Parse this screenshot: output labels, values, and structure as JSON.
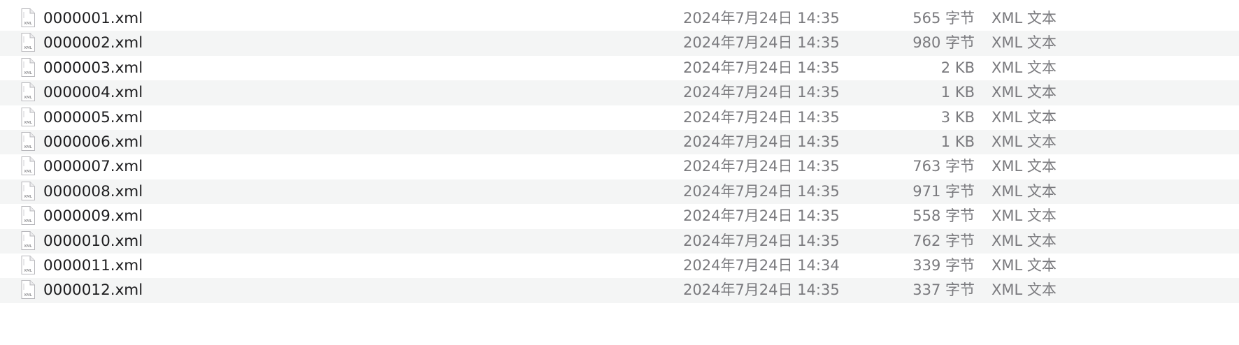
{
  "icon": {
    "name": "xml-file-icon",
    "label": "XML"
  },
  "files": [
    {
      "name": "0000001.xml",
      "date": "2024年7月24日 14:35",
      "size": "565 字节",
      "kind": "XML 文本"
    },
    {
      "name": "0000002.xml",
      "date": "2024年7月24日 14:35",
      "size": "980 字节",
      "kind": "XML 文本"
    },
    {
      "name": "0000003.xml",
      "date": "2024年7月24日 14:35",
      "size": "2 KB",
      "kind": "XML 文本"
    },
    {
      "name": "0000004.xml",
      "date": "2024年7月24日 14:35",
      "size": "1 KB",
      "kind": "XML 文本"
    },
    {
      "name": "0000005.xml",
      "date": "2024年7月24日 14:35",
      "size": "3 KB",
      "kind": "XML 文本"
    },
    {
      "name": "0000006.xml",
      "date": "2024年7月24日 14:35",
      "size": "1 KB",
      "kind": "XML 文本"
    },
    {
      "name": "0000007.xml",
      "date": "2024年7月24日 14:35",
      "size": "763 字节",
      "kind": "XML 文本"
    },
    {
      "name": "0000008.xml",
      "date": "2024年7月24日 14:35",
      "size": "971 字节",
      "kind": "XML 文本"
    },
    {
      "name": "0000009.xml",
      "date": "2024年7月24日 14:35",
      "size": "558 字节",
      "kind": "XML 文本"
    },
    {
      "name": "0000010.xml",
      "date": "2024年7月24日 14:35",
      "size": "762 字节",
      "kind": "XML 文本"
    },
    {
      "name": "0000011.xml",
      "date": "2024年7月24日 14:34",
      "size": "339 字节",
      "kind": "XML 文本"
    },
    {
      "name": "0000012.xml",
      "date": "2024年7月24日 14:35",
      "size": "337 字节",
      "kind": "XML 文本"
    }
  ],
  "colors": {
    "stripe": "#f4f5f5",
    "name_text": "#1d1d1f",
    "meta_text": "#7a7a7e"
  }
}
